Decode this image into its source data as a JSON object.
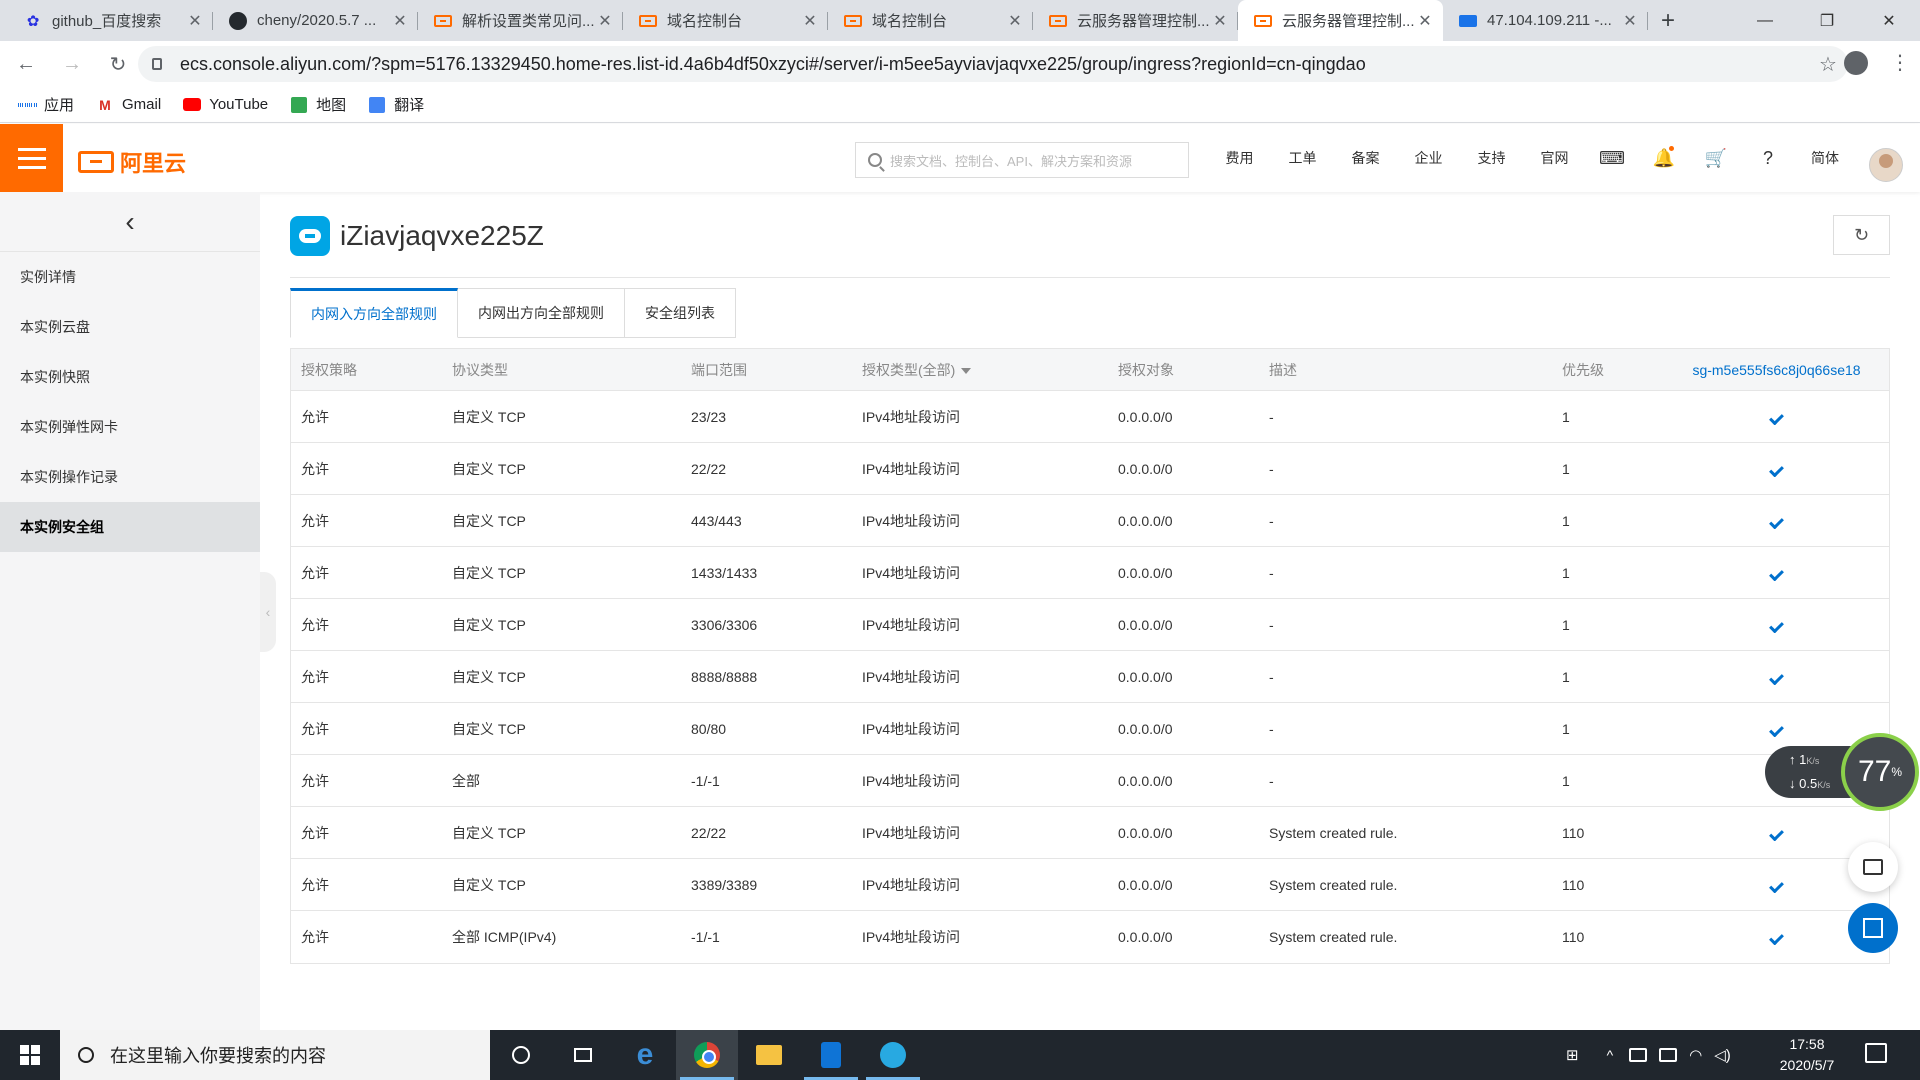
{
  "browser": {
    "tabs": [
      {
        "title": "github_百度搜索",
        "favicon": "baidu-icon",
        "active": false
      },
      {
        "title": "cheny/2020.5.7 ...",
        "favicon": "github-icon",
        "active": false
      },
      {
        "title": "解析设置类常见问...",
        "favicon": "aliyun-icon",
        "active": false
      },
      {
        "title": "域名控制台",
        "favicon": "aliyun-icon",
        "active": false
      },
      {
        "title": "域名控制台",
        "favicon": "aliyun-icon",
        "active": false
      },
      {
        "title": "云服务器管理控制...",
        "favicon": "aliyun-icon",
        "active": false
      },
      {
        "title": "云服务器管理控制...",
        "favicon": "aliyun-icon",
        "active": true
      },
      {
        "title": "47.104.109.211 -...",
        "favicon": "remote-desktop-icon",
        "active": false
      }
    ],
    "url": "ecs.console.aliyun.com/?spm=5176.13329450.home-res.list-id.4a6b4df50xzyci#/server/i-m5ee5ayviavjaqvxe225/group/ingress?regionId=cn-qingdao",
    "bookmarks": [
      {
        "label": "应用",
        "icon": "apps-grid-icon"
      },
      {
        "label": "Gmail",
        "icon": "gmail-icon"
      },
      {
        "label": "YouTube",
        "icon": "youtube-icon"
      },
      {
        "label": "地图",
        "icon": "maps-icon"
      },
      {
        "label": "翻译",
        "icon": "translate-icon"
      }
    ]
  },
  "console": {
    "logo_text": "阿里云",
    "search_placeholder": "搜索文档、控制台、API、解决方案和资源",
    "nav": [
      "费用",
      "工单",
      "备案",
      "企业",
      "支持",
      "官网"
    ],
    "lang": "简体"
  },
  "sidebar": {
    "items": [
      {
        "label": "实例详情",
        "active": false
      },
      {
        "label": "本实例云盘",
        "active": false
      },
      {
        "label": "本实例快照",
        "active": false
      },
      {
        "label": "本实例弹性网卡",
        "active": false
      },
      {
        "label": "本实例操作记录",
        "active": false
      },
      {
        "label": "本实例安全组",
        "active": true
      }
    ]
  },
  "main": {
    "title": "iZiavjaqvxe225Z",
    "tabs": [
      {
        "label": "内网入方向全部规则",
        "active": true
      },
      {
        "label": "内网出方向全部规则",
        "active": false
      },
      {
        "label": "安全组列表",
        "active": false
      }
    ],
    "table": {
      "headers": [
        "授权策略",
        "协议类型",
        "端口范围",
        "授权类型(全部)",
        "授权对象",
        "描述",
        "优先级",
        "sg-m5e555fs6c8j0q66se18"
      ],
      "rows": [
        [
          "允许",
          "自定义 TCP",
          "23/23",
          "IPv4地址段访问",
          "0.0.0.0/0",
          "-",
          "1"
        ],
        [
          "允许",
          "自定义 TCP",
          "22/22",
          "IPv4地址段访问",
          "0.0.0.0/0",
          "-",
          "1"
        ],
        [
          "允许",
          "自定义 TCP",
          "443/443",
          "IPv4地址段访问",
          "0.0.0.0/0",
          "-",
          "1"
        ],
        [
          "允许",
          "自定义 TCP",
          "1433/1433",
          "IPv4地址段访问",
          "0.0.0.0/0",
          "-",
          "1"
        ],
        [
          "允许",
          "自定义 TCP",
          "3306/3306",
          "IPv4地址段访问",
          "0.0.0.0/0",
          "-",
          "1"
        ],
        [
          "允许",
          "自定义 TCP",
          "8888/8888",
          "IPv4地址段访问",
          "0.0.0.0/0",
          "-",
          "1"
        ],
        [
          "允许",
          "自定义 TCP",
          "80/80",
          "IPv4地址段访问",
          "0.0.0.0/0",
          "-",
          "1"
        ],
        [
          "允许",
          "全部",
          "-1/-1",
          "IPv4地址段访问",
          "0.0.0.0/0",
          "-",
          "1"
        ],
        [
          "允许",
          "自定义 TCP",
          "22/22",
          "IPv4地址段访问",
          "0.0.0.0/0",
          "System created rule.",
          "110"
        ],
        [
          "允许",
          "自定义 TCP",
          "3389/3389",
          "IPv4地址段访问",
          "0.0.0.0/0",
          "System created rule.",
          "110"
        ],
        [
          "允许",
          "全部 ICMP(IPv4)",
          "-1/-1",
          "IPv4地址段访问",
          "0.0.0.0/0",
          "System created rule.",
          "110"
        ]
      ]
    }
  },
  "speed_widget": {
    "upload": "1",
    "upload_unit": "K/s",
    "download": "0.5",
    "download_unit": "K/s",
    "cpu": "77",
    "cpu_unit": "%"
  },
  "taskbar": {
    "search_placeholder": "在这里输入你要搜索的内容",
    "time": "17:58",
    "date": "2020/5/7"
  },
  "colors": {
    "accent": "#ff6a00",
    "link": "#0070cc"
  }
}
